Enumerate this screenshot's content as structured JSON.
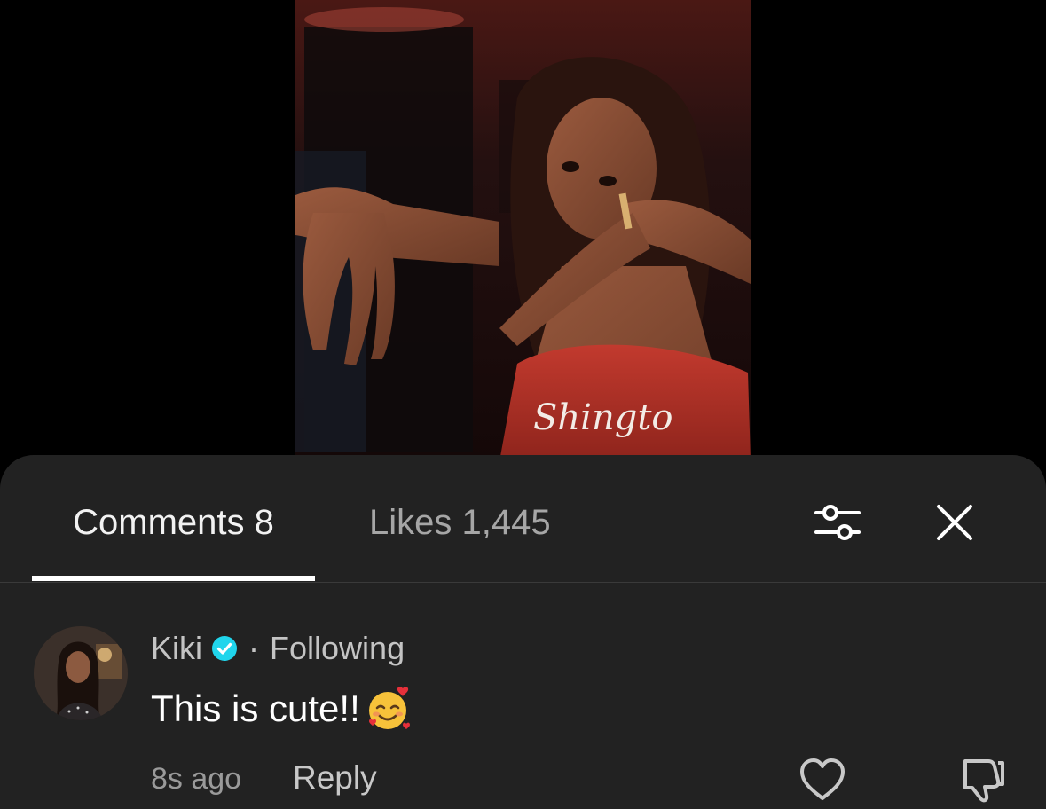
{
  "video": {
    "jersey_text": "Shingto"
  },
  "tabs": {
    "comments_label": "Comments 8",
    "likes_label": "Likes",
    "likes_count": "1,445"
  },
  "icons": {
    "filter": "sliders-icon",
    "close": "close-icon",
    "verified": "verified-badge-icon",
    "heart": "heart-icon",
    "dislike": "thumbs-down-icon",
    "emoji": "smiling-face-with-hearts-emoji"
  },
  "colors": {
    "sheet_bg": "#222222",
    "verified_blue": "#20d5ec",
    "text_primary": "#ffffff",
    "text_secondary": "#a6a6a6"
  },
  "comment": {
    "username": "Kiki",
    "separator": "·",
    "relationship": "Following",
    "text": "This is cute!!",
    "emoji": "🥰",
    "time": "8s ago",
    "reply_label": "Reply"
  }
}
